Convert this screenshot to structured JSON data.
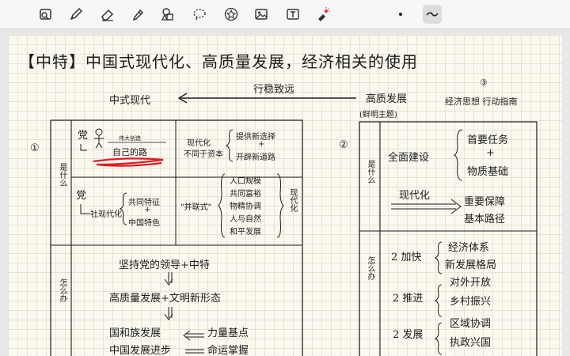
{
  "toolbar": {
    "tools": [
      {
        "name": "lasso-text-tool",
        "icon": "lasso-text-icon"
      },
      {
        "name": "pen-tool",
        "icon": "pen-icon"
      },
      {
        "name": "eraser-tool",
        "icon": "eraser-icon"
      },
      {
        "name": "highlighter-tool",
        "icon": "highlighter-icon"
      },
      {
        "name": "shapes-tool",
        "icon": "shapes-icon"
      },
      {
        "name": "lasso-tool",
        "icon": "lasso-icon"
      },
      {
        "name": "sticker-tool",
        "icon": "star-icon"
      },
      {
        "name": "image-tool",
        "icon": "image-icon"
      },
      {
        "name": "text-tool",
        "icon": "text-box-icon"
      },
      {
        "name": "laser-tool",
        "icon": "laser-pointer-icon"
      },
      {
        "name": "dot-size",
        "icon": "dot-icon"
      },
      {
        "name": "stroke-style",
        "icon": "wave-stroke-icon"
      }
    ],
    "accent": "#333333"
  },
  "note": {
    "title": "【中特】中国式现代化、高质量发展，经济相关的使用",
    "top_left": "中式现代",
    "arrow_label": "行稳致远",
    "top_right": "高质发展",
    "top_right_sub": "(鲜明主题)",
    "circle3": "③",
    "guide": "经济思想 行动指南",
    "circle1": "①",
    "circle2": "②",
    "row_what": "是什么",
    "row_how": "怎么办",
    "party": "党",
    "great_creation": "伟大创造",
    "own_road": "自己的路",
    "modern_label": "现代化",
    "not_capital": "不同于资本",
    "provide_new": "提供新选择",
    "plus1": "+",
    "open_new": "开辟新道路",
    "party2": "党",
    "social_modern": "社现代化",
    "common_feature": "共同特征",
    "plus2": "+",
    "china_feature": "中国特色",
    "five_items": "\"并联式\"",
    "pop_scale": "人口规模",
    "common_rich": "共同富裕",
    "material_spirit": "物精协调",
    "man_nature": "人与自然",
    "peace_dev": "和平发展",
    "modern_vert": "现代化",
    "uphold": "坚持党的领导+中特",
    "hq_dev": "高质量发展+文明新形态",
    "nation_dev": "国和族发展",
    "power_point": "力量基点",
    "china_dev": "中国发展进步",
    "fate": "命运掌握",
    "build": "全面建设",
    "primary_task": "首要任务",
    "plus3": "+",
    "material_base": "物质基础",
    "modernize": "现代化",
    "important_guarantee": "重要保障",
    "basic_path": "基本路径",
    "speed_up": "2 加快",
    "econ_system": "经济体系",
    "new_pattern": "新发展格局",
    "promote": "2 推进",
    "open_up": "对外开放",
    "rural": "乡村振兴",
    "develop": "2 发展",
    "regional": "区域协调",
    "governance": "执政兴国"
  }
}
